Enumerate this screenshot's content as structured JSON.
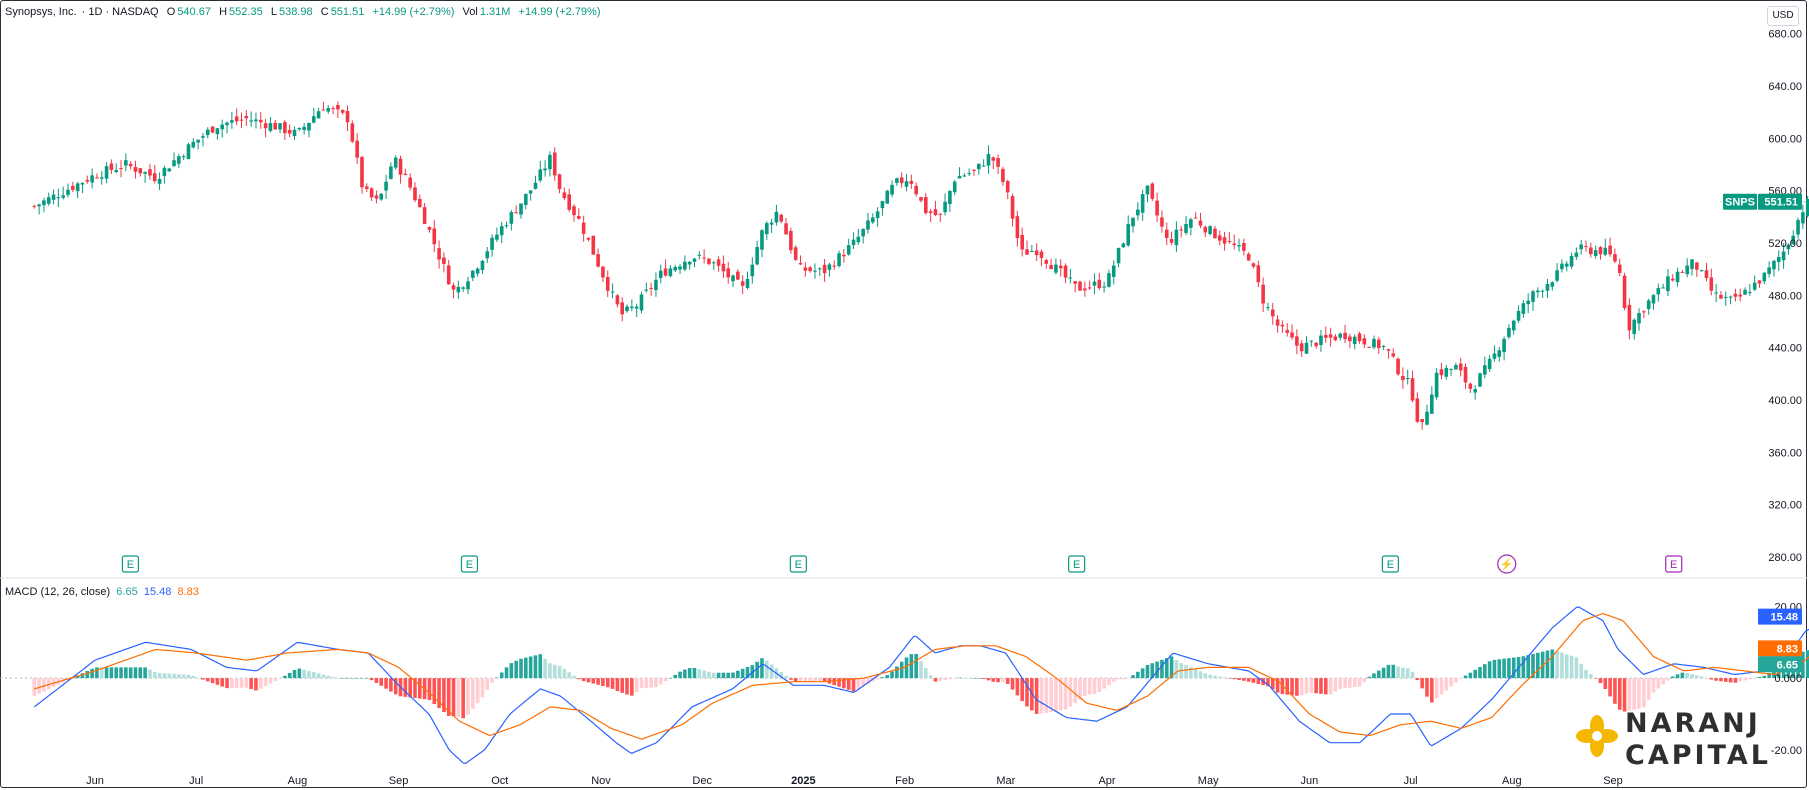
{
  "header": {
    "symbol_name": "Synopsys, Inc.",
    "interval_exchange": " · 1D · NASDAQ",
    "o_label": "O",
    "o_value": "540.67",
    "h_label": "H",
    "h_value": "552.35",
    "l_label": "L",
    "l_value": "538.98",
    "c_label": "C",
    "c_value": "551.51",
    "change": "+14.99 (+2.79%)",
    "vol_label": "Vol",
    "vol_value": "1.31M",
    "vol_change": "+14.99 (+2.79%)",
    "currency": "USD"
  },
  "price_tag": {
    "symbol": "SNPS",
    "value": "551.51"
  },
  "macd_legend": {
    "label": "MACD (12, 26, close)",
    "hist": "6.65",
    "macd": "15.48",
    "signal": "8.83"
  },
  "macd_tags": {
    "macd": "15.48",
    "signal": "8.83",
    "hist": "6.65"
  },
  "colors": {
    "up": "#089981",
    "down": "#f23645",
    "macd": "#2962ff",
    "signal": "#ff6d00",
    "hist_up_strong": "#26a69a",
    "hist_up_weak": "#b2dfdb",
    "hist_down_strong": "#ff5252",
    "hist_down_weak": "#ffcdd2",
    "event_earnings": "#089981",
    "event_other": "#9c27b0"
  },
  "events": [
    {
      "label": "E",
      "kind": "earnings",
      "month_pos": 0.35
    },
    {
      "label": "E",
      "kind": "earnings",
      "month_pos": 3.7
    },
    {
      "label": "E",
      "kind": "earnings",
      "month_pos": 6.95
    },
    {
      "label": "E",
      "kind": "earnings",
      "month_pos": 9.7
    },
    {
      "label": "E",
      "kind": "earnings",
      "month_pos": 12.8
    },
    {
      "label": "⚡",
      "kind": "dividend",
      "month_pos": 13.95
    },
    {
      "label": "E",
      "kind": "upcoming",
      "month_pos": 15.6
    }
  ],
  "logo": {
    "line1": "NARANJ",
    "line2": "CAPITAL"
  },
  "chart_data": [
    {
      "type": "candlestick",
      "title": "Synopsys, Inc. · 1D · NASDAQ",
      "x_ticks": [
        "Jun",
        "Jul",
        "Aug",
        "Sep",
        "Oct",
        "Nov",
        "Dec",
        "2025",
        "Feb",
        "Mar",
        "Apr",
        "May",
        "Jun",
        "Jul",
        "Aug",
        "Sep"
      ],
      "y_ticks": [
        "680.00",
        "640.00",
        "600.00",
        "560.00",
        "520.00",
        "480.00",
        "440.00",
        "400.00",
        "360.00",
        "320.00",
        "280.00"
      ],
      "ylim": [
        270,
        695
      ],
      "close_path": [
        [
          -0.6,
          548
        ],
        [
          -0.3,
          560
        ],
        [
          0,
          572
        ],
        [
          0.3,
          580
        ],
        [
          0.6,
          570
        ],
        [
          0.95,
          595
        ],
        [
          1.2,
          610
        ],
        [
          1.5,
          615
        ],
        [
          1.75,
          610
        ],
        [
          2,
          603
        ],
        [
          2.25,
          625
        ],
        [
          2.5,
          615
        ],
        [
          2.65,
          560
        ],
        [
          2.8,
          550
        ],
        [
          2.95,
          585
        ],
        [
          3.1,
          565
        ],
        [
          3.25,
          540
        ],
        [
          3.4,
          510
        ],
        [
          3.55,
          482
        ],
        [
          3.75,
          500
        ],
        [
          4,
          530
        ],
        [
          4.3,
          560
        ],
        [
          4.5,
          585
        ],
        [
          4.6,
          560
        ],
        [
          4.8,
          535
        ],
        [
          5.05,
          490
        ],
        [
          5.2,
          465
        ],
        [
          5.35,
          472
        ],
        [
          5.6,
          497
        ],
        [
          5.9,
          510
        ],
        [
          6.1,
          505
        ],
        [
          6.4,
          485
        ],
        [
          6.6,
          530
        ],
        [
          6.75,
          545
        ],
        [
          6.95,
          500
        ],
        [
          7.2,
          498
        ],
        [
          7.5,
          520
        ],
        [
          7.7,
          540
        ],
        [
          7.9,
          565
        ],
        [
          8.05,
          570
        ],
        [
          8.2,
          545
        ],
        [
          8.35,
          540
        ],
        [
          8.5,
          570
        ],
        [
          8.7,
          575
        ],
        [
          8.85,
          588
        ],
        [
          9.0,
          562
        ],
        [
          9.15,
          512
        ],
        [
          9.3,
          515
        ],
        [
          9.5,
          500
        ],
        [
          9.7,
          485
        ],
        [
          10,
          490
        ],
        [
          10.25,
          540
        ],
        [
          10.4,
          560
        ],
        [
          10.6,
          520
        ],
        [
          10.85,
          540
        ],
        [
          11.0,
          530
        ],
        [
          11.2,
          520
        ],
        [
          11.4,
          510
        ],
        [
          11.55,
          475
        ],
        [
          11.7,
          455
        ],
        [
          11.9,
          440
        ],
        [
          12.1,
          445
        ],
        [
          12.35,
          450
        ],
        [
          12.55,
          445
        ],
        [
          12.75,
          440
        ],
        [
          12.9,
          420
        ],
        [
          13.0,
          410
        ],
        [
          13.1,
          375
        ],
        [
          13.25,
          420
        ],
        [
          13.45,
          425
        ],
        [
          13.6,
          408
        ],
        [
          13.8,
          430
        ],
        [
          14.0,
          460
        ],
        [
          14.2,
          480
        ],
        [
          14.45,
          496
        ],
        [
          14.65,
          515
        ],
        [
          14.9,
          514
        ],
        [
          15.05,
          505
        ],
        [
          15.15,
          455
        ],
        [
          15.35,
          475
        ],
        [
          15.6,
          495
        ],
        [
          15.8,
          505
        ],
        [
          16.0,
          480
        ],
        [
          16.2,
          475
        ],
        [
          16.5,
          495
        ],
        [
          16.7,
          515
        ],
        [
          16.9,
          550
        ],
        [
          17.05,
          551.51
        ]
      ]
    },
    {
      "type": "line",
      "title": "MACD (12, 26, close)",
      "y_ticks": [
        "20.00",
        "0.000",
        "-20.00"
      ],
      "ylim": [
        -27,
        24
      ],
      "series": [
        {
          "name": "MACD",
          "color": "#2962ff",
          "points": [
            [
              -0.6,
              -8
            ],
            [
              0,
              5
            ],
            [
              0.5,
              10
            ],
            [
              0.95,
              8
            ],
            [
              1.3,
              3
            ],
            [
              1.6,
              2
            ],
            [
              2,
              10
            ],
            [
              2.4,
              8
            ],
            [
              2.7,
              7
            ],
            [
              3.0,
              -2
            ],
            [
              3.3,
              -10
            ],
            [
              3.5,
              -20
            ],
            [
              3.65,
              -24
            ],
            [
              3.85,
              -20
            ],
            [
              4.1,
              -10
            ],
            [
              4.4,
              -3
            ],
            [
              4.6,
              -5
            ],
            [
              4.9,
              -12
            ],
            [
              5.15,
              -18
            ],
            [
              5.3,
              -21
            ],
            [
              5.55,
              -18
            ],
            [
              5.9,
              -8
            ],
            [
              6.3,
              -3
            ],
            [
              6.6,
              4
            ],
            [
              6.9,
              -2
            ],
            [
              7.2,
              -2
            ],
            [
              7.5,
              -4
            ],
            [
              7.85,
              3
            ],
            [
              8.1,
              12
            ],
            [
              8.3,
              7
            ],
            [
              8.55,
              9
            ],
            [
              8.75,
              9
            ],
            [
              9.0,
              7
            ],
            [
              9.3,
              -6
            ],
            [
              9.6,
              -11
            ],
            [
              9.9,
              -12
            ],
            [
              10.2,
              -8
            ],
            [
              10.5,
              2
            ],
            [
              10.65,
              7
            ],
            [
              11.0,
              4
            ],
            [
              11.4,
              2
            ],
            [
              11.6,
              -2
            ],
            [
              11.9,
              -12
            ],
            [
              12.2,
              -18
            ],
            [
              12.5,
              -18
            ],
            [
              12.8,
              -10
            ],
            [
              13.0,
              -10
            ],
            [
              13.2,
              -19
            ],
            [
              13.5,
              -14
            ],
            [
              13.8,
              -6
            ],
            [
              14.1,
              4
            ],
            [
              14.4,
              14
            ],
            [
              14.65,
              20
            ],
            [
              14.9,
              16
            ],
            [
              15.05,
              8
            ],
            [
              15.3,
              1
            ],
            [
              15.6,
              4
            ],
            [
              15.9,
              3
            ],
            [
              16.2,
              1
            ],
            [
              16.5,
              2
            ],
            [
              16.7,
              5
            ],
            [
              16.9,
              13
            ],
            [
              17.05,
              15.48
            ]
          ]
        },
        {
          "name": "Signal",
          "color": "#ff6d00",
          "points": [
            [
              -0.6,
              -3
            ],
            [
              0,
              2
            ],
            [
              0.6,
              8
            ],
            [
              1.0,
              7
            ],
            [
              1.5,
              5
            ],
            [
              1.9,
              7
            ],
            [
              2.4,
              8
            ],
            [
              2.7,
              7
            ],
            [
              3.0,
              3
            ],
            [
              3.3,
              -4
            ],
            [
              3.6,
              -12
            ],
            [
              3.9,
              -16
            ],
            [
              4.2,
              -13
            ],
            [
              4.5,
              -8
            ],
            [
              4.8,
              -9
            ],
            [
              5.1,
              -14
            ],
            [
              5.4,
              -17
            ],
            [
              5.8,
              -13
            ],
            [
              6.1,
              -7
            ],
            [
              6.5,
              -2
            ],
            [
              6.9,
              -1
            ],
            [
              7.2,
              -1
            ],
            [
              7.6,
              0
            ],
            [
              8.0,
              3
            ],
            [
              8.3,
              8
            ],
            [
              8.6,
              9
            ],
            [
              8.9,
              9
            ],
            [
              9.2,
              6
            ],
            [
              9.5,
              0
            ],
            [
              9.8,
              -7
            ],
            [
              10.1,
              -9
            ],
            [
              10.4,
              -5
            ],
            [
              10.7,
              2
            ],
            [
              11.0,
              3
            ],
            [
              11.4,
              3
            ],
            [
              11.7,
              -1
            ],
            [
              12.0,
              -10
            ],
            [
              12.3,
              -15
            ],
            [
              12.6,
              -16
            ],
            [
              12.9,
              -13
            ],
            [
              13.2,
              -12
            ],
            [
              13.5,
              -14
            ],
            [
              13.8,
              -11
            ],
            [
              14.1,
              -2
            ],
            [
              14.4,
              6
            ],
            [
              14.7,
              16
            ],
            [
              14.9,
              18
            ],
            [
              15.1,
              16
            ],
            [
              15.4,
              6
            ],
            [
              15.7,
              2
            ],
            [
              16.0,
              3
            ],
            [
              16.3,
              2
            ],
            [
              16.6,
              1
            ],
            [
              16.9,
              5
            ],
            [
              17.05,
              8.83
            ]
          ]
        }
      ]
    }
  ]
}
